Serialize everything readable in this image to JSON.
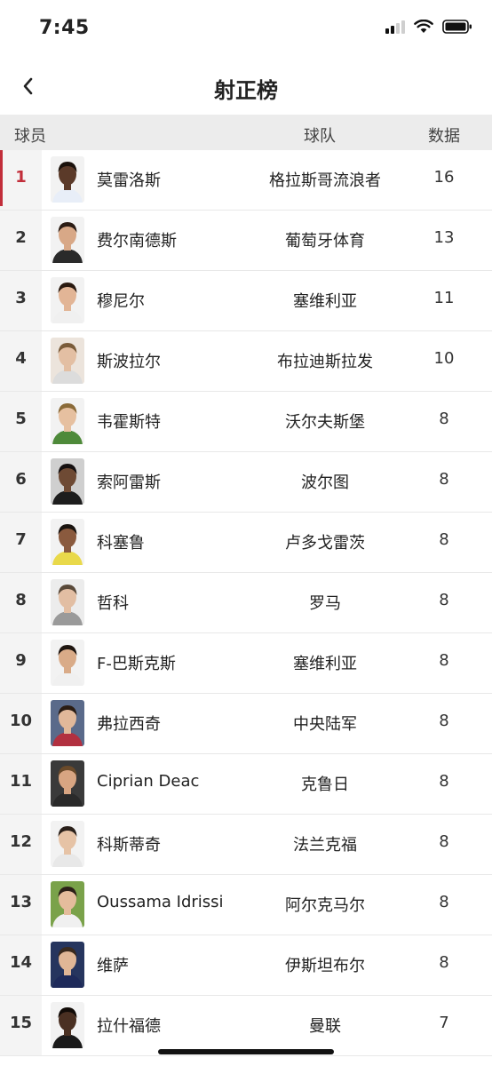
{
  "status_bar": {
    "time": "7:45"
  },
  "nav": {
    "title": "射正榜"
  },
  "table": {
    "headers": {
      "player": "球员",
      "team": "球队",
      "stat": "数据"
    },
    "rows": [
      {
        "rank": "1",
        "name": "莫雷洛斯",
        "team": "格拉斯哥流浪者",
        "value": "16",
        "avatar": {
          "skin": "#5b3a29",
          "hair": "#1b120c",
          "shirt": "#e8eef8",
          "bg": "#f2f2f2"
        }
      },
      {
        "rank": "2",
        "name": "费尔南德斯",
        "team": "葡萄牙体育",
        "value": "13",
        "avatar": {
          "skin": "#d8a887",
          "hair": "#2b1c14",
          "shirt": "#2a2a2a",
          "bg": "#f2f2f2"
        }
      },
      {
        "rank": "3",
        "name": "穆尼尔",
        "team": "塞维利亚",
        "value": "11",
        "avatar": {
          "skin": "#e2b596",
          "hair": "#2a1a10",
          "shirt": "#f0f0f0",
          "bg": "#f2f2f2"
        }
      },
      {
        "rank": "4",
        "name": "斯波拉尔",
        "team": "布拉迪斯拉发",
        "value": "10",
        "avatar": {
          "skin": "#e3bfa3",
          "hair": "#7a5c3a",
          "shirt": "#dcdcdc",
          "bg": "#ece4dc"
        }
      },
      {
        "rank": "5",
        "name": "韦霍斯特",
        "team": "沃尔夫斯堡",
        "value": "8",
        "avatar": {
          "skin": "#e6c0a0",
          "hair": "#8a6a38",
          "shirt": "#4e8a3a",
          "bg": "#f2f2f2"
        }
      },
      {
        "rank": "6",
        "name": "索阿雷斯",
        "team": "波尔图",
        "value": "8",
        "avatar": {
          "skin": "#6e4a34",
          "hair": "#151010",
          "shirt": "#1d1d1d",
          "bg": "#cfcfcf"
        }
      },
      {
        "rank": "7",
        "name": "科塞鲁",
        "team": "卢多戈雷茨",
        "value": "8",
        "avatar": {
          "skin": "#8a5a3e",
          "hair": "#1a1410",
          "shirt": "#e9d94a",
          "bg": "#f2f2f2"
        }
      },
      {
        "rank": "8",
        "name": "哲科",
        "team": "罗马",
        "value": "8",
        "avatar": {
          "skin": "#e2bea3",
          "hair": "#5a4a3a",
          "shirt": "#9a9a9a",
          "bg": "#ececec"
        }
      },
      {
        "rank": "9",
        "name": "F-巴斯克斯",
        "team": "塞维利亚",
        "value": "8",
        "avatar": {
          "skin": "#d9ab88",
          "hair": "#1e1510",
          "shirt": "#f0f0f0",
          "bg": "#f2f2f2"
        }
      },
      {
        "rank": "10",
        "name": "弗拉西奇",
        "team": "中央陆军",
        "value": "8",
        "avatar": {
          "skin": "#e1b89a",
          "hair": "#2a1c14",
          "shirt": "#b23040",
          "bg": "#5a6a8a"
        }
      },
      {
        "rank": "11",
        "name": "Ciprian Deac",
        "team": "克鲁日",
        "value": "8",
        "avatar": {
          "skin": "#d8a582",
          "hair": "#6a4a2a",
          "shirt": "#2a2a2a",
          "bg": "#3a3a3a"
        }
      },
      {
        "rank": "12",
        "name": "科斯蒂奇",
        "team": "法兰克福",
        "value": "8",
        "avatar": {
          "skin": "#e6c3a6",
          "hair": "#2a201a",
          "shirt": "#e8e8e8",
          "bg": "#f2f2f2"
        }
      },
      {
        "rank": "13",
        "name": "Oussama Idrissi",
        "team": "阿尔克马尔",
        "value": "8",
        "avatar": {
          "skin": "#e4bc9c",
          "hair": "#2c2018",
          "shirt": "#f0f0f0",
          "bg": "#7aa24a"
        }
      },
      {
        "rank": "14",
        "name": "维萨",
        "team": "伊斯坦布尔",
        "value": "8",
        "avatar": {
          "skin": "#e0b696",
          "hair": "#3a2a1e",
          "shirt": "#1e2a5a",
          "bg": "#26355e"
        }
      },
      {
        "rank": "15",
        "name": "拉什福德",
        "team": "曼联",
        "value": "7",
        "avatar": {
          "skin": "#4a3022",
          "hair": "#120c08",
          "shirt": "#1a1a1a",
          "bg": "#f2f2f2"
        }
      }
    ]
  }
}
